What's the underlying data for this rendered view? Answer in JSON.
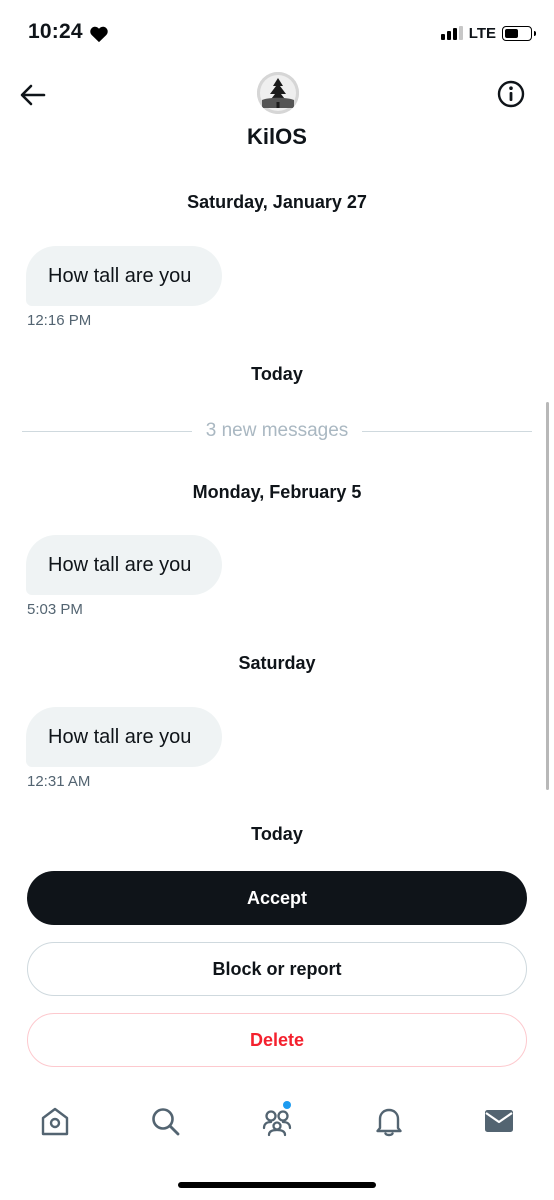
{
  "status_bar": {
    "time": "10:24",
    "network": "LTE"
  },
  "header": {
    "name": "KilOS"
  },
  "conversation": {
    "sections": [
      {
        "date": "Saturday, January 27",
        "message": "How tall are you",
        "time": "12:16 PM"
      },
      {
        "date": "Today"
      },
      {
        "new_messages": "3 new messages"
      },
      {
        "date": "Monday, February 5",
        "message": "How tall are you",
        "time": "5:03 PM"
      },
      {
        "date": "Saturday",
        "message": "How tall are you",
        "time": "12:31 AM"
      },
      {
        "date": "Today"
      }
    ]
  },
  "actions": {
    "accept": "Accept",
    "block_or_report": "Block or report",
    "delete": "Delete"
  },
  "bottom_nav": {
    "items": [
      "home",
      "search",
      "communities",
      "notifications",
      "messages"
    ],
    "communities_has_dot": true
  },
  "colors": {
    "accent": "#1d9bf0",
    "danger": "#f4212e",
    "bubble": "#eff3f4",
    "primary_button": "#0f1419"
  }
}
